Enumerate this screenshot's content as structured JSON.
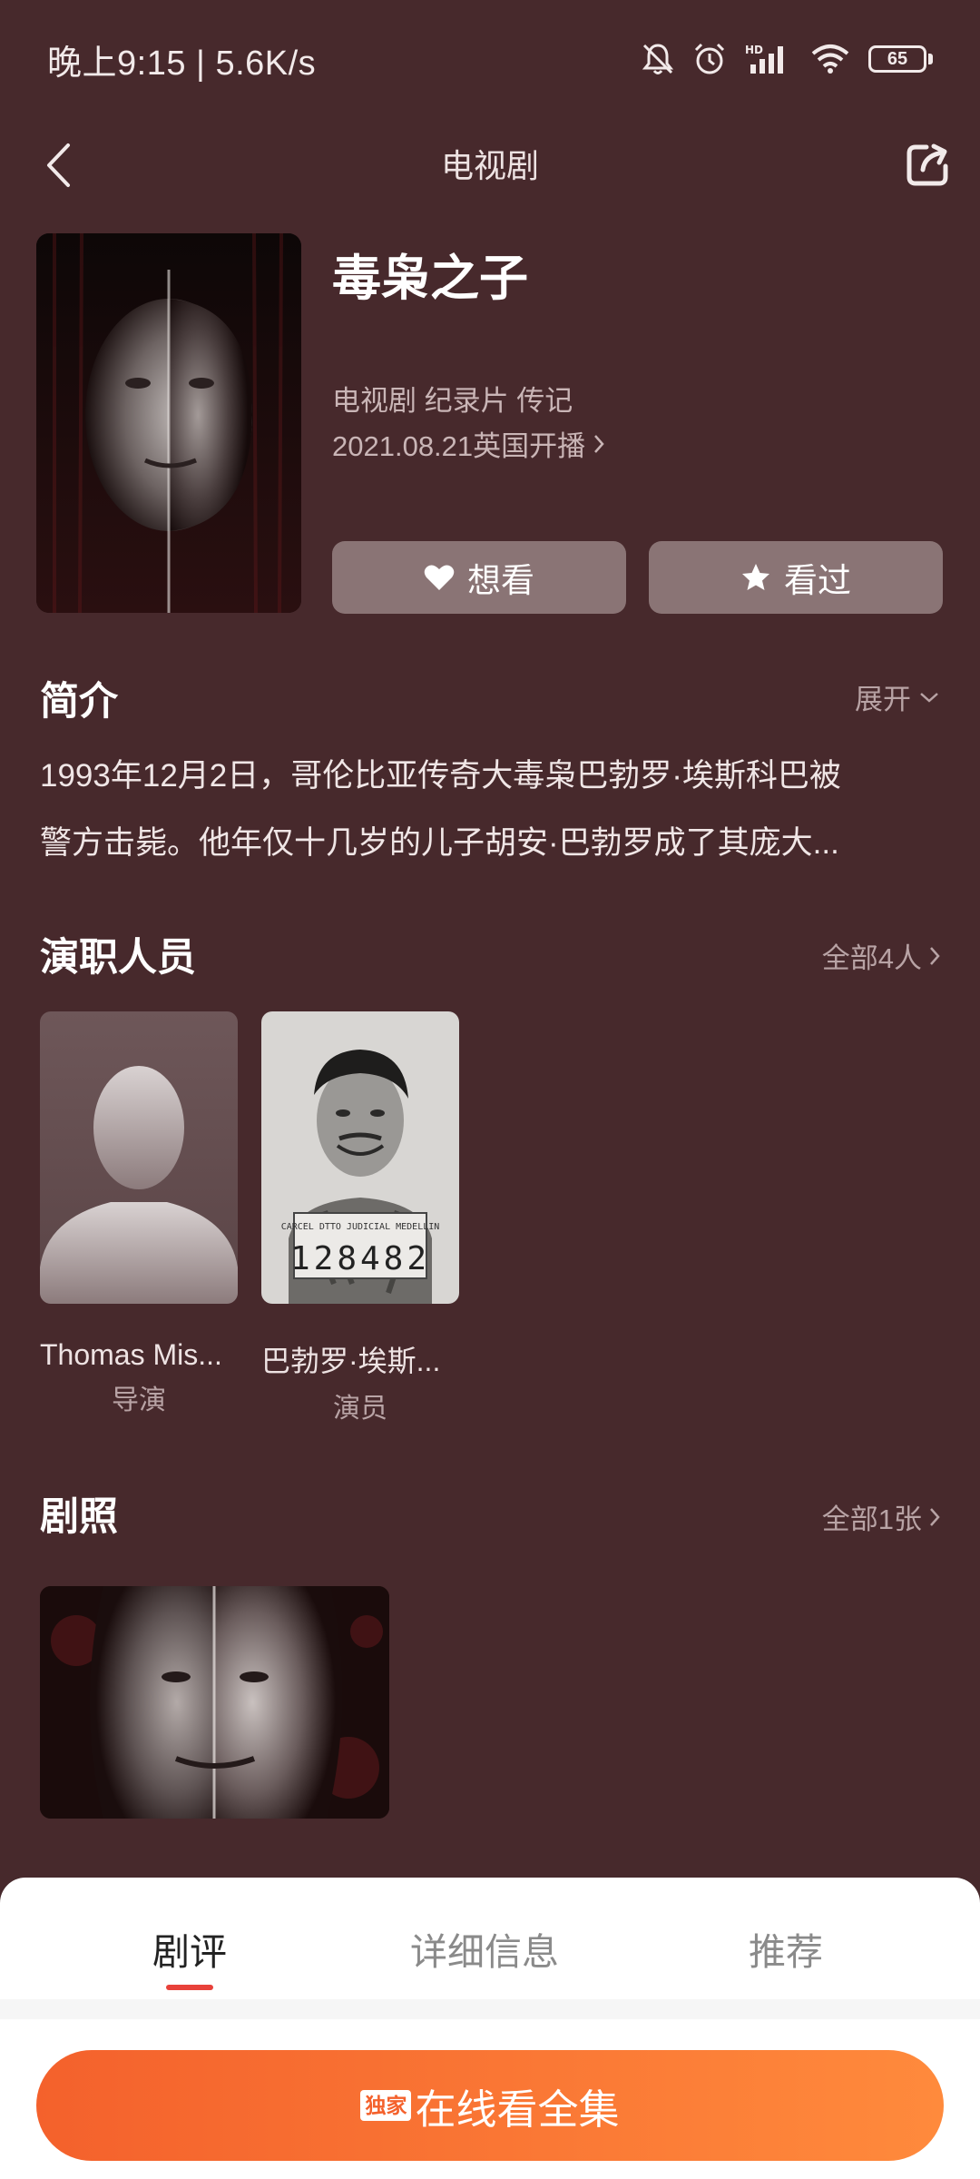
{
  "status_bar": {
    "time": "晚上9:15 | 5.6K/s",
    "battery": "65",
    "icons": [
      "mute-bell-icon",
      "alarm-icon",
      "hd-signal-icon",
      "wifi-icon",
      "battery-icon"
    ]
  },
  "nav": {
    "title": "电视剧",
    "back_icon": "chevron-left-icon",
    "share_icon": "share-icon"
  },
  "show": {
    "title": "毒枭之子",
    "genres": "电视剧 纪录片 传记",
    "release": "2021.08.21英国开播"
  },
  "actions": {
    "want_label": "想看",
    "seen_label": "看过"
  },
  "synopsis": {
    "heading": "简介",
    "expand_label": "展开",
    "line1": "1993年12月2日，哥伦比亚传奇大毒枭巴勃罗·埃斯科巴被",
    "line2": "警方击毙。他年仅十几岁的儿子胡安·巴勃罗成了其庞大..."
  },
  "cast": {
    "heading": "演职人员",
    "more_label": "全部4人",
    "members": [
      {
        "name": "Thomas Mis...",
        "role": "导演"
      },
      {
        "name": "巴勃罗·埃斯...",
        "role": "演员",
        "mugshot_number": "128482",
        "mugshot_text": "CARCEL DTTO JUDICIAL MEDELLIN"
      }
    ]
  },
  "stills": {
    "heading": "剧照",
    "more_label": "全部1张"
  },
  "bottom_tabs": {
    "tabs": [
      "剧评",
      "详细信息",
      "推荐"
    ],
    "active_index": 0
  },
  "watch": {
    "badge": "独家",
    "label": "在线看全集"
  },
  "colors": {
    "background": "#47292c",
    "accent": "#f4612c",
    "tab_underline": "#e8413a"
  }
}
